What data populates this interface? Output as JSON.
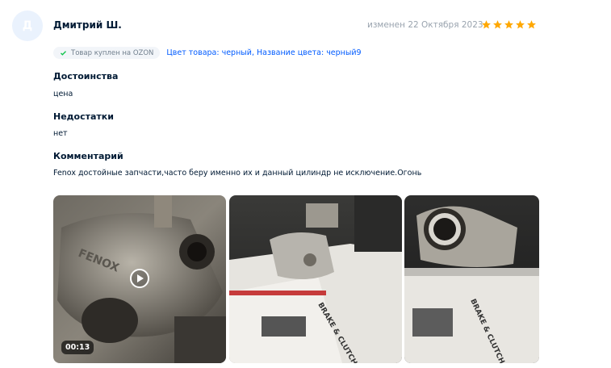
{
  "review": {
    "avatar_letter": "Д",
    "author": "Дмитрий Ш.",
    "date": "изменен 22 Октября 2023",
    "rating": 5,
    "star_color": "#ffa800",
    "badge": "Товар куплен на OZON",
    "variant": "Цвет товара: черный, Название цвета: черный9",
    "sections": [
      {
        "title": "Достоинства",
        "text": "цена"
      },
      {
        "title": "Недостатки",
        "text": "нет"
      },
      {
        "title": "Комментарий",
        "text": "Fenox достойные запчасти,часто беру именно их и данный цилиндр не исключение.Огонь"
      }
    ],
    "media": [
      {
        "type": "video",
        "duration": "00:13",
        "icon": "play-icon"
      },
      {
        "type": "photo"
      },
      {
        "type": "photo"
      }
    ]
  }
}
